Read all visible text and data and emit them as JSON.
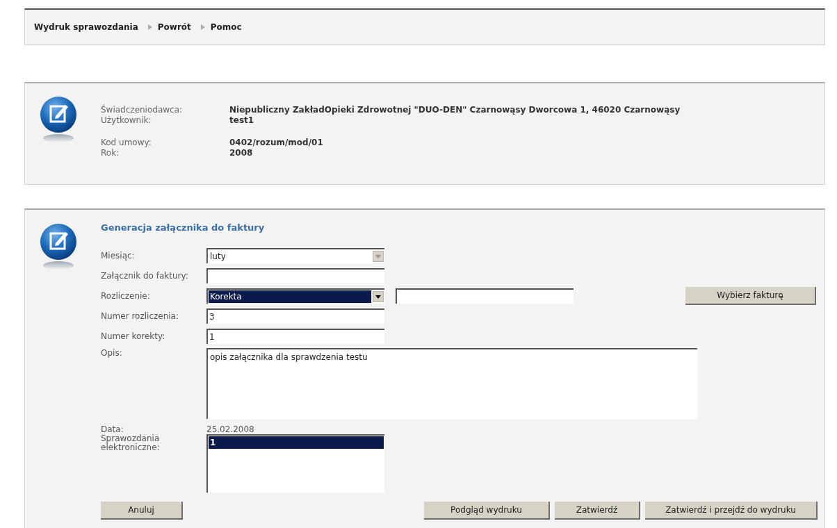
{
  "nav": [
    {
      "label": "Wydruk sprawozdania"
    },
    {
      "label": "Powrót"
    },
    {
      "label": "Pomoc"
    }
  ],
  "info": {
    "groups": [
      [
        {
          "label": "Świadczeniodawca:",
          "value": "Niepubliczny ZakładOpieki Zdrowotnej \"DUO-DEN\" Czarnowąsy Dworcowa 1, 46020 Czarnowąsy"
        },
        {
          "label": "Użytkownik:",
          "value": "test1"
        }
      ],
      [
        {
          "label": "Kod umowy:",
          "value": "0402/rozum/mod/01"
        },
        {
          "label": "Rok:",
          "value": "2008"
        }
      ]
    ]
  },
  "form": {
    "title": "Generacja załącznika do faktury",
    "fields": [
      {
        "kind": "select",
        "label": "Miesiąc:",
        "value": "luty",
        "highlighted": false
      },
      {
        "kind": "text",
        "label": "Załącznik do faktury:"
      },
      {
        "kind": "select",
        "label": "Rozliczenie:",
        "value": "Korekta",
        "highlighted": true,
        "side_input": true,
        "side_button": "Wybierz fakturę"
      },
      {
        "kind": "text",
        "label": "Numer rozliczenia:",
        "value": "3"
      },
      {
        "kind": "text",
        "label": "Numer korekty:",
        "value": "1"
      },
      {
        "kind": "textarea",
        "label": "Opis:",
        "value": "opis załącznika dla sprawdzenia testu"
      },
      {
        "kind": "static",
        "label": "Data:",
        "value": "25.02.2008"
      },
      {
        "kind": "listbox",
        "label": "Sprawozdania elektroniczne:",
        "items": [
          {
            "label": "1",
            "selected": true
          }
        ]
      }
    ],
    "cancel_button": "Anuluj",
    "buttons": [
      "Podgląd wydruku",
      "Zatwierdź",
      "Zatwierdź i przejdź do wydruku"
    ]
  }
}
